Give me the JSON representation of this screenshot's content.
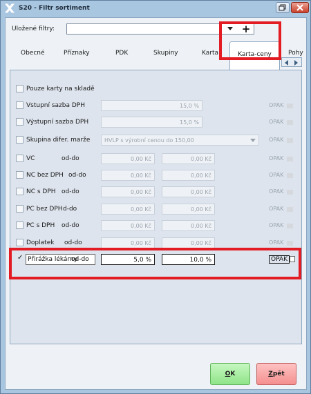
{
  "window": {
    "title": "S20 - Filtr sortiment"
  },
  "filters": {
    "label": "Uložené filtry:",
    "value": "",
    "add_label": "+"
  },
  "tabs": [
    {
      "label": "Obecné"
    },
    {
      "label": "Příznaky"
    },
    {
      "label": "PDK"
    },
    {
      "label": "Skupiny"
    },
    {
      "label": "Karta"
    },
    {
      "label": "Karta-ceny",
      "active": true
    },
    {
      "label": "Pohy"
    }
  ],
  "rows": [
    {
      "label": "Pouze karty na skladě",
      "checked": false
    },
    {
      "label": "Vstupní sazba DPH",
      "checked": false,
      "value": "15,0 %",
      "opak": "OPAK"
    },
    {
      "label": "Výstupní sazba DPH",
      "checked": false,
      "value": "15,0 %",
      "opak": "OPAK"
    },
    {
      "label": "Skupina difer. marže",
      "checked": false,
      "select": "HVLP s výrobní cenou do 150,00",
      "opak": "OPAK"
    },
    {
      "label": "VC",
      "od": "od-do",
      "checked": false,
      "from": "0,00 Kč",
      "to": "0,00 Kč",
      "opak": "OPAK"
    },
    {
      "label": "NC bez DPH",
      "od": "od-do",
      "checked": false,
      "from": "0,00 Kč",
      "to": "0,00 Kč",
      "opak": "OPAK"
    },
    {
      "label": "NC s DPH",
      "od": "od-do",
      "checked": false,
      "from": "0,00 Kč",
      "to": "0,00 Kč",
      "opak": "OPAK"
    },
    {
      "label": "PC bez DPH",
      "od": "d-do",
      "checked": false,
      "from": "0,00 Kč",
      "to": "0,00 Kč",
      "opak": "OPAK"
    },
    {
      "label": "PC s DPH",
      "od": "od-do",
      "checked": false,
      "from": "0,00 Kč",
      "to": "0,00 Kč",
      "opak": "OPAK"
    },
    {
      "label": "Doplatek",
      "od": "od-do",
      "checked": false,
      "from": "0,00 Kč",
      "to": "0,00 Kč",
      "opak": "OPAK"
    },
    {
      "label": "Přirážka lékárny",
      "od": "od-do",
      "checked": true,
      "tick": "✓",
      "from": "5,0 %",
      "to": "10,0 %",
      "opak": "OPAK"
    }
  ],
  "buttons": {
    "ok_accel": "O",
    "ok_rest": "K",
    "back_accel": "Z",
    "back_rest": "pět"
  },
  "colors": {
    "highlight": "#e31b23",
    "ok_bg": "#9be894",
    "back_bg": "#f7a0a0",
    "title_bg": "#a9c6e0"
  }
}
